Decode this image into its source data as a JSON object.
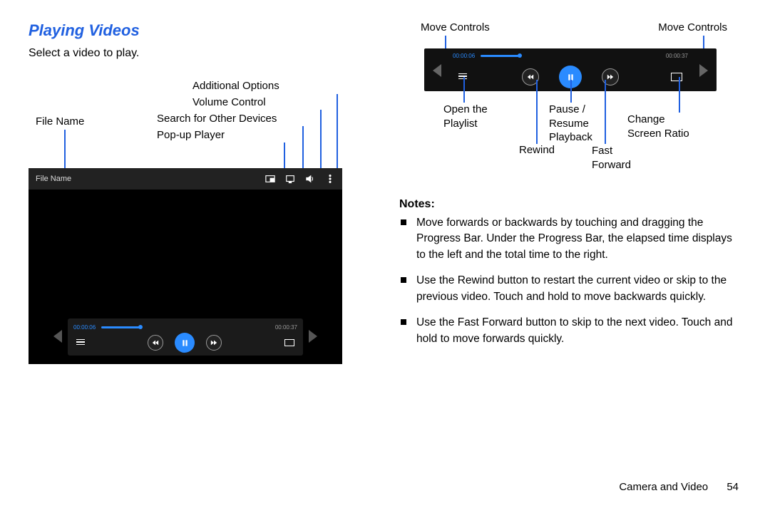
{
  "heading": "Playing Videos",
  "intro": "Select a video to play.",
  "left_labels": {
    "file_name": "File Name",
    "additional_options": "Additional Options",
    "volume_control": "Volume Control",
    "search_devices": "Search for Other Devices",
    "popup_player": "Pop-up Player"
  },
  "player": {
    "file_name_display": "File Name",
    "elapsed": "00:00:06",
    "total": "00:00:37"
  },
  "right_labels": {
    "move_controls1": "Move Controls",
    "move_controls2": "Move Controls",
    "open_playlist": "Open the Playlist",
    "pause_resume": "Pause / Resume Playback",
    "change_ratio": "Change Screen Ratio",
    "rewind": "Rewind",
    "fast_forward": "Fast Forward"
  },
  "notes_heading": "Notes:",
  "notes": [
    "Move forwards or backwards by touching and dragging the Progress Bar. Under the Progress Bar, the elapsed time displays to the left and the total time to the right.",
    "Use the Rewind button to restart the current video or skip to the previous video. Touch and hold to move backwards quickly.",
    "Use the Fast Forward button to skip to the next video. Touch and hold to move forwards quickly."
  ],
  "footer_section": "Camera and Video",
  "footer_page": "54"
}
